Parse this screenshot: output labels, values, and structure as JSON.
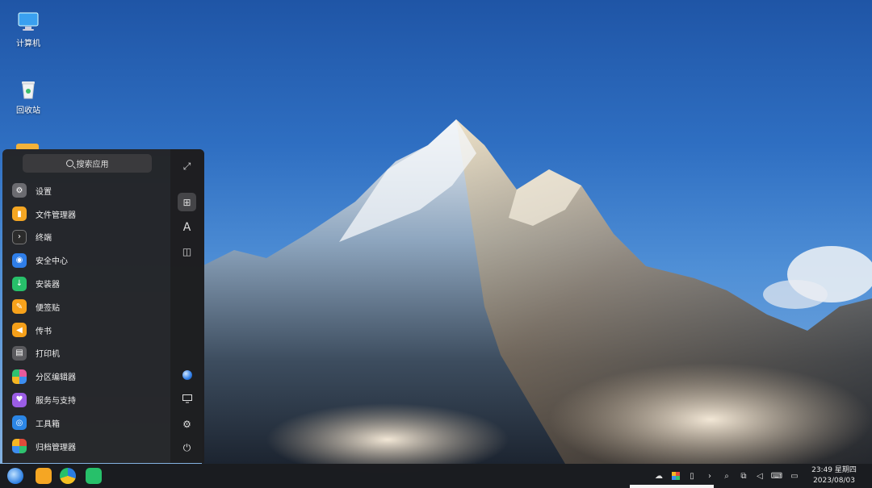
{
  "desktop": {
    "icons": [
      {
        "label": "计算机",
        "icon": "computer-icon"
      },
      {
        "label": "回收站",
        "icon": "trash-icon"
      }
    ]
  },
  "launcher": {
    "search_placeholder": "搜索应用",
    "apps": [
      {
        "label": "设置",
        "icon": "settings-icon",
        "color": "#6b6b70"
      },
      {
        "label": "文件管理器",
        "icon": "folder-icon",
        "color": "#f5a623"
      },
      {
        "label": "终端",
        "icon": "terminal-icon",
        "color": "#2b2b2b"
      },
      {
        "label": "安全中心",
        "icon": "shield-icon",
        "color": "#2f7ee8"
      },
      {
        "label": "安装器",
        "icon": "installer-icon",
        "color": "#27c06a"
      },
      {
        "label": "便签贴",
        "icon": "note-icon",
        "color": "#f7a21b"
      },
      {
        "label": "传书",
        "icon": "transfer-icon",
        "color": "#f5a01a"
      },
      {
        "label": "打印机",
        "icon": "printer-icon",
        "color": "#5a5a5e"
      },
      {
        "label": "分区编辑器",
        "icon": "partition-icon",
        "color": "#e85a9c"
      },
      {
        "label": "服务与支持",
        "icon": "heart-icon",
        "color": "#9b5de5"
      },
      {
        "label": "工具箱",
        "icon": "toolbox-icon",
        "color": "#2b86e6"
      },
      {
        "label": "归档管理器",
        "icon": "archive-icon",
        "color": "#e04b3a"
      }
    ],
    "side_buttons": [
      {
        "icon": "expand-icon",
        "glyph": "⤢"
      },
      {
        "icon": "grid-view-icon",
        "glyph": "⊞"
      },
      {
        "icon": "alphabet-sort-icon",
        "glyph": "A"
      },
      {
        "icon": "category-view-icon",
        "glyph": "◫"
      }
    ],
    "bottom_buttons": [
      {
        "icon": "user-avatar-icon",
        "glyph": "●"
      },
      {
        "icon": "display-icon",
        "glyph": "🖵"
      },
      {
        "icon": "settings-gear-icon",
        "glyph": "⚙"
      },
      {
        "icon": "power-icon",
        "glyph": "⏻"
      }
    ]
  },
  "taskbar": {
    "apps": [
      {
        "icon": "start-menu-icon"
      },
      {
        "icon": "file-manager-icon"
      },
      {
        "icon": "browser-icon"
      },
      {
        "icon": "app-store-icon"
      }
    ],
    "tray": [
      {
        "icon": "cloud-icon",
        "glyph": "☁"
      },
      {
        "icon": "color-app-icon",
        "glyph": "■"
      },
      {
        "icon": "clipboard-icon",
        "glyph": "▯"
      },
      {
        "icon": "expand-tray-icon",
        "glyph": "›"
      },
      {
        "icon": "search-icon",
        "glyph": "⌕"
      },
      {
        "icon": "screen-share-icon",
        "glyph": "⧉"
      },
      {
        "icon": "volume-icon",
        "glyph": "🔈"
      },
      {
        "icon": "keyboard-icon",
        "glyph": "⌨"
      },
      {
        "icon": "notification-icon",
        "glyph": "▭"
      }
    ],
    "time": "23:49 星期四",
    "date": "2023/08/03"
  }
}
